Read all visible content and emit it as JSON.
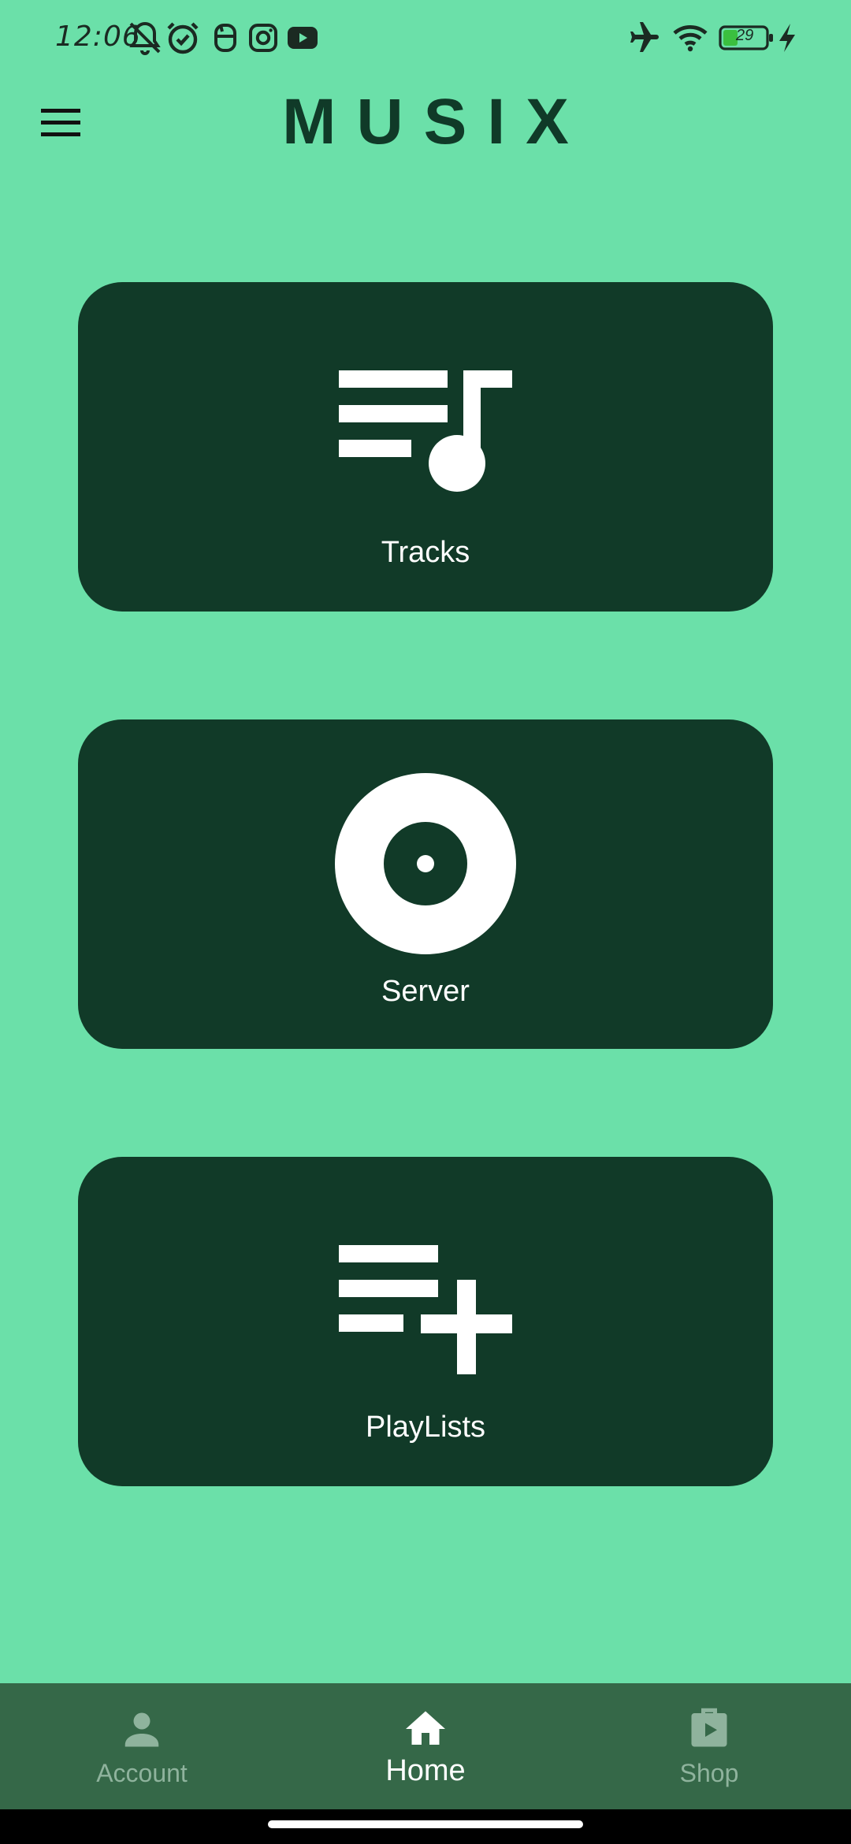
{
  "status_bar": {
    "time": "12:06",
    "battery_level": "29",
    "left_icons": [
      "bell-off-icon",
      "alarm-icon",
      "notification-app-icon",
      "instagram-icon",
      "youtube-icon"
    ],
    "right_icons": [
      "airplane-mode-icon",
      "wifi-icon",
      "battery-icon",
      "charging-icon"
    ]
  },
  "app_bar": {
    "title": "MUSIX",
    "menu_icon": "hamburger-menu-icon"
  },
  "cards": [
    {
      "label": "Tracks",
      "icon": "queue-music-icon"
    },
    {
      "label": "Server",
      "icon": "album-disc-icon"
    },
    {
      "label": "PlayLists",
      "icon": "playlist-add-icon"
    }
  ],
  "bottom_nav": {
    "items": [
      {
        "label": "Account",
        "icon": "person-icon",
        "active": false
      },
      {
        "label": "Home",
        "icon": "home-icon",
        "active": true
      },
      {
        "label": "Shop",
        "icon": "shop-icon",
        "active": false
      }
    ]
  },
  "colors": {
    "background": "#6be0a9",
    "card": "#113a28",
    "title": "#103a28",
    "nav_background": "#356848",
    "nav_inactive": "#8fb39d",
    "nav_active": "#ffffff"
  }
}
